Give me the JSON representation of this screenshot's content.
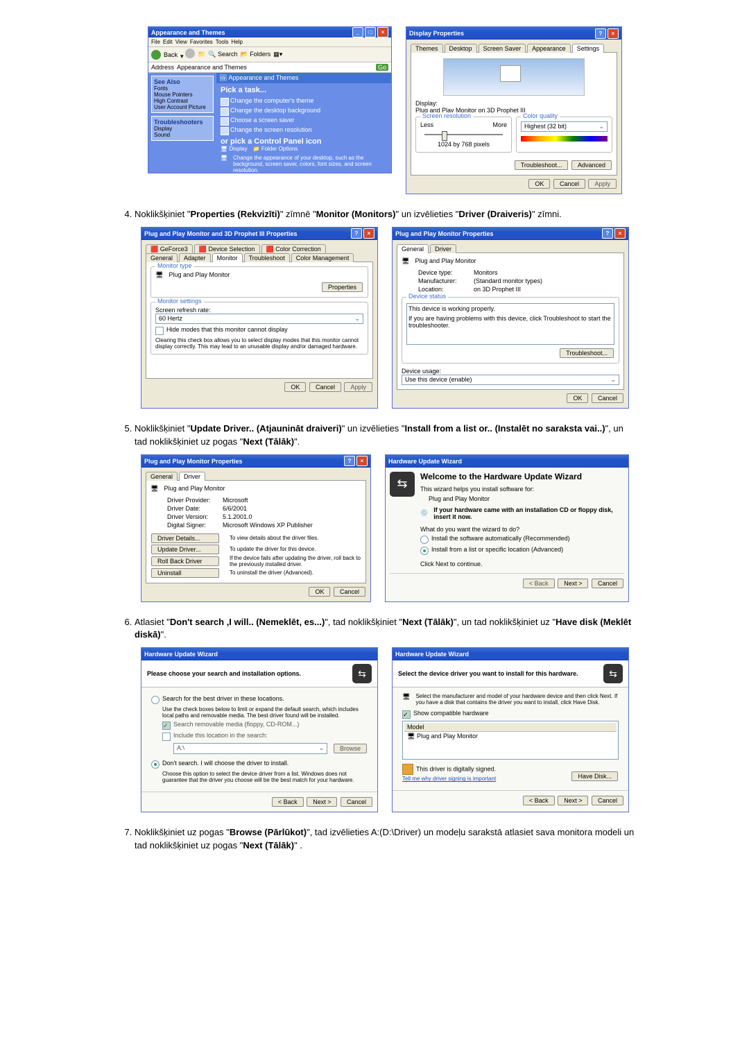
{
  "steps": {
    "s4": "Noklikšķiniet \"Properties (Rekvizīti)\" zīmnē \"Monitor (Monitors)\" un izvēlieties \"Driver (Draiveris)\" zīmni.",
    "s5": "Noklikšķiniet \"Update Driver.. (Atjaunināt draiveri)\" un izvēlieties \"Install from a list or.. (Instalēt no saraksta vai..)\", un tad noklikšķiniet uz pogas \"Next (Tālāk)\".",
    "s6": "Atlasiet \"Don't search ,I will.. (Nemeklēt, es...)\", tad noklikšķiniet \"Next (Tālāk)\", un tad noklikšķiniet uz \"Have disk (Meklēt diskā)\".",
    "s7": "Noklikšķiniet uz pogas \"Browse (Pārlūkot)\", tad izvēlieties A:(D:\\Driver) un modeļu sarakstā atlasiet sava monitora modeli un tad noklikšķiniet uz pogas \"Next (Tālāk)\" ."
  },
  "common": {
    "ok": "OK",
    "cancel": "Cancel",
    "apply": "Apply",
    "back": "< Back",
    "next": "Next >"
  },
  "appearance_cp": {
    "title": "Appearance and Themes",
    "menu": [
      "File",
      "Edit",
      "View",
      "Favorites",
      "Tools",
      "Help"
    ],
    "toolbar_back": "Back",
    "addr_label": "Address",
    "addr_value": "Appearance and Themes",
    "go": "Go",
    "side_header": "See Also",
    "side_items": [
      "Fonts",
      "Mouse Pointers",
      "High Contrast",
      "User Account Picture"
    ],
    "side_header2": "Troubleshooters",
    "side_items2": [
      "Display",
      "Sound"
    ],
    "main_header": "Appearance and Themes",
    "pick_task": "Pick a task...",
    "tasks": [
      "Change the computer's theme",
      "Change the desktop background",
      "Choose a screen saver",
      "Change the screen resolution"
    ],
    "or_pick": "or pick a Control Panel icon",
    "icons": [
      "Display",
      "Folder Options"
    ],
    "icon_desc": "Change the appearance of your desktop, such as the background, screen saver, colors, font sizes, and screen resolution."
  },
  "display_props": {
    "title": "Display Properties",
    "tabs": [
      "Themes",
      "Desktop",
      "Screen Saver",
      "Appearance",
      "Settings"
    ],
    "display_label": "Display:",
    "display_value": "Plug and Play Monitor on 3D Prophet III",
    "res_group": "Screen resolution",
    "less": "Less",
    "more": "More",
    "res_value": "1024 by 768 pixels",
    "quality_group": "Color quality",
    "quality_value": "Highest (32 bit)",
    "troubleshoot": "Troubleshoot...",
    "advanced": "Advanced"
  },
  "pnp_3d": {
    "title": "Plug and Play Monitor and 3D Prophet III Properties",
    "tabs1": [
      "GeForce3",
      "Device Selection",
      "Color Correction"
    ],
    "tabs2": [
      "General",
      "Adapter",
      "Monitor",
      "Troubleshoot",
      "Color Management"
    ],
    "g_type": "Monitor type",
    "mon_name": "Plug and Play Monitor",
    "properties": "Properties",
    "g_settings": "Monitor settings",
    "refresh_label": "Screen refresh rate:",
    "refresh_value": "60 Hertz",
    "hide_modes": "Hide modes that this monitor cannot display",
    "hide_desc": "Clearing this check box allows you to select display modes that this monitor cannot display correctly. This may lead to an unusable display and/or damaged hardware."
  },
  "pnp_gen": {
    "title": "Plug and Play Monitor Properties",
    "tabs": [
      "General",
      "Driver"
    ],
    "name": "Plug and Play Monitor",
    "devtype_k": "Device type:",
    "devtype_v": "Monitors",
    "manu_k": "Manufacturer:",
    "manu_v": "(Standard monitor types)",
    "loc_k": "Location:",
    "loc_v": "on 3D Prophet III",
    "status_group": "Device status",
    "status_text": "This device is working properly.",
    "status_help": "If you are having problems with this device, click Troubleshoot to start the troubleshooter.",
    "troubleshoot": "Troubleshoot...",
    "usage_label": "Device usage:",
    "usage_value": "Use this device (enable)"
  },
  "pnp_drv": {
    "title": "Plug and Play Monitor Properties",
    "tabs": [
      "General",
      "Driver"
    ],
    "name": "Plug and Play Monitor",
    "prov_k": "Driver Provider:",
    "prov_v": "Microsoft",
    "date_k": "Driver Date:",
    "date_v": "6/6/2001",
    "ver_k": "Driver Version:",
    "ver_v": "5.1.2001.0",
    "sig_k": "Digital Signer:",
    "sig_v": "Microsoft Windows XP Publisher",
    "b_details": "Driver Details...",
    "b_details_d": "To view details about the driver files.",
    "b_update": "Update Driver...",
    "b_update_d": "To update the driver for this device.",
    "b_roll": "Roll Back Driver",
    "b_roll_d": "If the device fails after updating the driver, roll back to the previously installed driver.",
    "b_uninst": "Uninstall",
    "b_uninst_d": "To uninstall the driver (Advanced)."
  },
  "wiz1": {
    "title": "Hardware Update Wizard",
    "welcome": "Welcome to the Hardware Update Wizard",
    "helps": "This wizard helps you install software for:",
    "device": "Plug and Play Monitor",
    "cd_hint": "If your hardware came with an installation CD or floppy disk, insert it now.",
    "q": "What do you want the wizard to do?",
    "opt_auto": "Install the software automatically (Recommended)",
    "opt_list": "Install from a list or specific location (Advanced)",
    "cont": "Click Next to continue."
  },
  "wiz2": {
    "title": "Hardware Update Wizard",
    "header": "Please choose your search and installation options.",
    "opt_search": "Search for the best driver in these locations.",
    "search_desc": "Use the check boxes below to limit or expand the default search, which includes local paths and removable media. The best driver found will be installed.",
    "chk_media": "Search removable media (floppy, CD-ROM...)",
    "chk_loc": "Include this location in the search:",
    "loc_value": "A:\\",
    "browse": "Browse",
    "opt_dont": "Don't search. I will choose the driver to install.",
    "dont_desc": "Choose this option to select the device driver from a list. Windows does not guarantee that the driver you choose will be the best match for your hardware."
  },
  "wiz3": {
    "title": "Hardware Update Wizard",
    "header": "Select the device driver you want to install for this hardware.",
    "intro": "Select the manufacturer and model of your hardware device and then click Next. If you have a disk that contains the driver you want to install, click Have Disk.",
    "compat": "Show compatible hardware",
    "model_label": "Model",
    "model_item": "Plug and Play Monitor",
    "signed": "This driver is digitally signed.",
    "why": "Tell me why driver signing is important",
    "have_disk": "Have Disk..."
  }
}
